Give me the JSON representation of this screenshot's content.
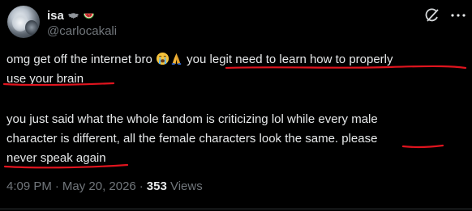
{
  "user": {
    "display_name": "isa",
    "handle": "@carlocakali",
    "name_emojis": [
      "bat",
      "watermelon"
    ]
  },
  "header_icons": {
    "grok": "grok-icon",
    "more": "more-dots-icon"
  },
  "tweet": {
    "p1_line1_a": "omg get off the internet bro ",
    "p1_line1_b": " you legit need to learn how to properly",
    "p1_line2": "use your brain",
    "p1_emojis": [
      "loudly-crying-face",
      "folded-hands"
    ],
    "p2_line1": "you just said what the whole fandom is criticizing lol while every male",
    "p2_line2": "character is different, all the female characters look the same. please",
    "p2_line3": "never speak again"
  },
  "meta": {
    "time": "4:09 PM",
    "date": "May 20, 2026",
    "dot": "·",
    "views_count": "353",
    "views_label": "Views"
  },
  "colors": {
    "background": "#000000",
    "text": "#e7e9ea",
    "secondary": "#71767b",
    "annotation": "#e0141e"
  }
}
